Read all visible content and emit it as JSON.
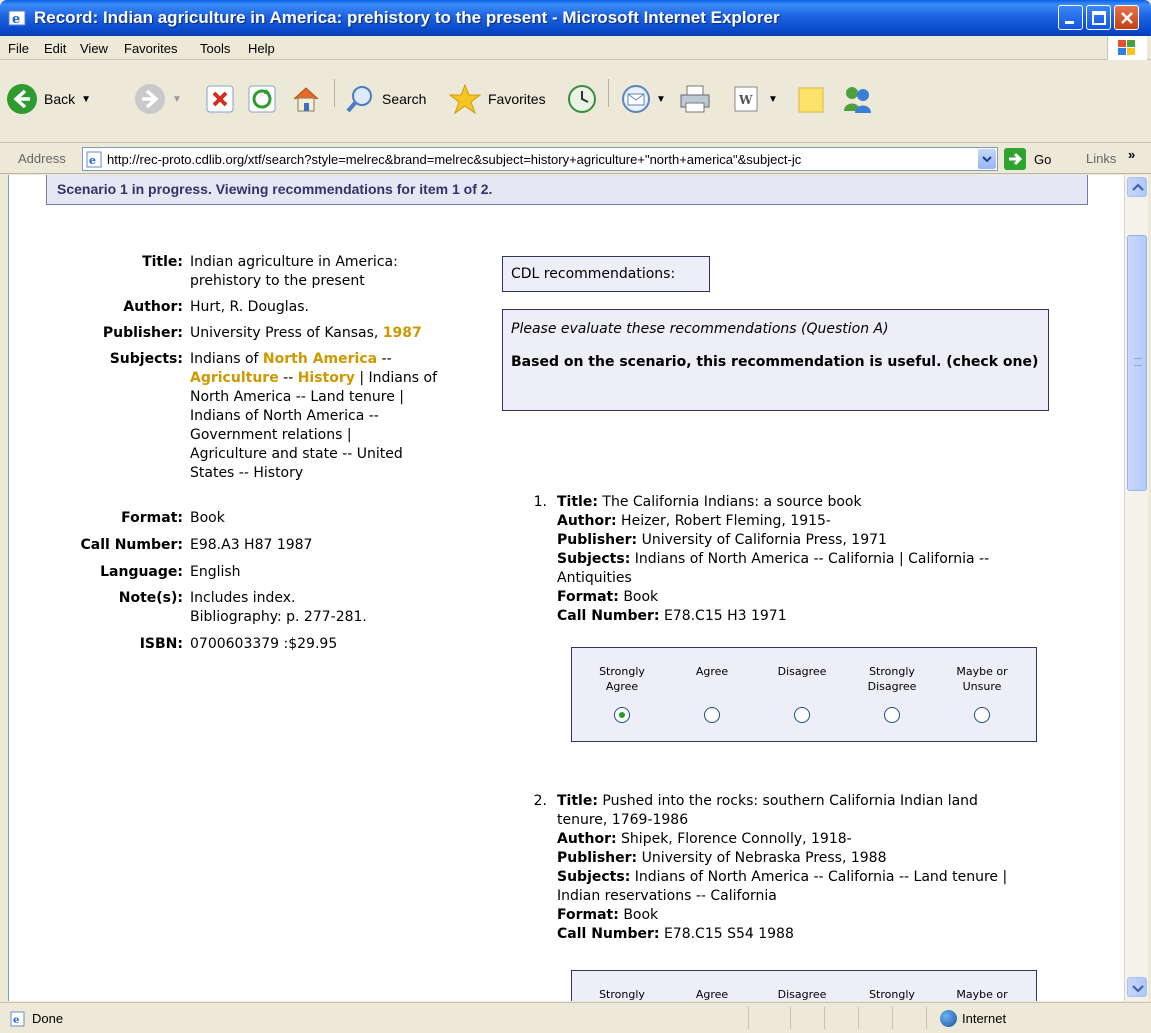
{
  "window": {
    "title": "Record: Indian agriculture in America: prehistory to the present - Microsoft Internet Explorer"
  },
  "menu": [
    "File",
    "Edit",
    "View",
    "Favorites",
    "Tools",
    "Help"
  ],
  "toolbar": {
    "back": "Back",
    "search": "Search",
    "favorites": "Favorites"
  },
  "address": {
    "label": "Address",
    "url": "http://rec-proto.cdlib.org/xtf/search?style=melrec&brand=melrec&subject=history+agriculture+\"north+america\"&subject-jc",
    "go": "Go",
    "links": "Links",
    "links_more": "»"
  },
  "scenario": "Scenario 1 in progress. Viewing recommendations for item 1 of 2.",
  "record": {
    "title_label": "Title:",
    "title_l1": "Indian agriculture in America:",
    "title_l2": "prehistory to the present",
    "author_label": "Author:",
    "author": "Hurt, R. Douglas.",
    "publisher_label": "Publisher:",
    "publisher": "University Press of Kansas, ",
    "year": "1987",
    "subjects_label": "Subjects:",
    "subj_1a": "Indians of ",
    "subj_1b": "North America",
    "subj_1c": " --",
    "subj_2a": "Agriculture",
    "subj_2b": " -- ",
    "subj_2c": "History",
    "subj_2d": " | Indians of",
    "subj_3": "North America -- Land tenure |",
    "subj_4": "Indians of North America --",
    "subj_5": "Government relations |",
    "subj_6": "Agriculture and state -- United",
    "subj_7": "States -- History",
    "format_label": "Format:",
    "format": "Book",
    "call_label": "Call Number:",
    "call": "E98.A3 H87 1987",
    "language_label": "Language:",
    "language": "English",
    "notes_label": "Note(s):",
    "notes_l1": "Includes index.",
    "notes_l2": "Bibliography: p. 277-281.",
    "isbn_label": "ISBN:",
    "isbn": "0700603379 :$29.95"
  },
  "cdl_label": "CDL recommendations:",
  "evaluation": {
    "instruction": "Please evaluate these recommendations (Question A)",
    "question": "Based on the scenario, this recommendation is useful. (check one)"
  },
  "labels": {
    "title": "Title:",
    "author": "Author:",
    "publisher": "Publisher:",
    "subjects": "Subjects:",
    "format": "Format:",
    "call": "Call Number:"
  },
  "recommendations": [
    {
      "num": "1.",
      "title": "The California Indians: a source book",
      "author": "Heizer, Robert Fleming, 1915-",
      "publisher": "University of California Press, 1971",
      "subjects_l1": "Indians of North America -- California | California --",
      "subjects_l2": "Antiquities",
      "format": "Book",
      "call": "E78.C15 H3 1971",
      "selected": "Strongly Agree"
    },
    {
      "num": "2.",
      "title_l1": "Pushed into the rocks: southern California Indian land",
      "title_l2": "tenure, 1769-1986",
      "author": "Shipek, Florence Connolly, 1918-",
      "publisher": "University of Nebraska Press, 1988",
      "subjects_l1": "Indians of North America -- California -- Land tenure |",
      "subjects_l2": "Indian reservations -- California",
      "format": "Book",
      "call": "E78.C15 S54 1988"
    }
  ],
  "rating_options": [
    {
      "l1": "Strongly",
      "l2": "Agree"
    },
    {
      "l1": "Agree",
      "l2": ""
    },
    {
      "l1": "Disagree",
      "l2": ""
    },
    {
      "l1": "Strongly",
      "l2": "Disagree"
    },
    {
      "l1": "Maybe or",
      "l2": "Unsure"
    }
  ],
  "status": {
    "text": "Done",
    "zone": "Internet"
  }
}
